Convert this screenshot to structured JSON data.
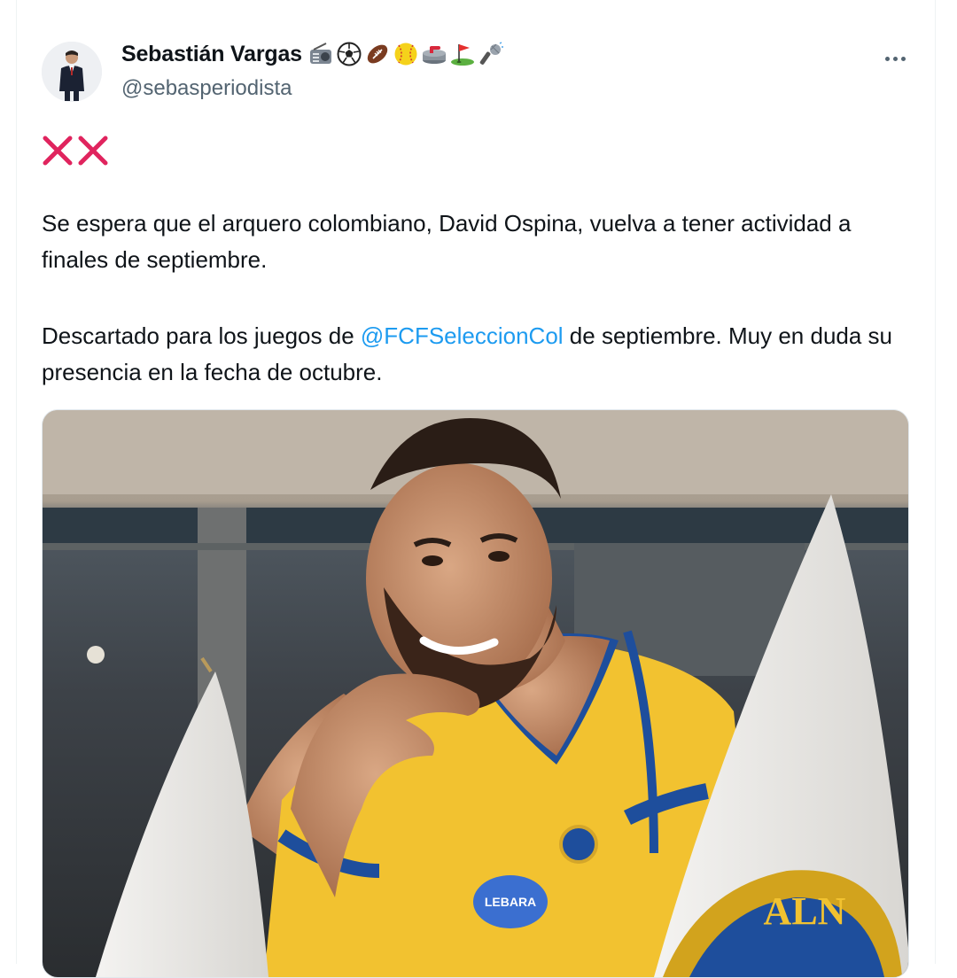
{
  "tweet": {
    "author_name": "Sebastián Vargas",
    "author_handle": "@sebasperiodista",
    "name_emojis": [
      "radio-icon",
      "soccer-ball-icon",
      "american-football-icon",
      "softball-icon",
      "curling-stone-icon",
      "golf-flag-icon",
      "microphone-icon"
    ],
    "marker_emoji": "cross-mark-icon",
    "paragraph_1": "Se espera que el arquero colombiano, David Ospina, vuelva a tener actividad a finales de septiembre.",
    "paragraph_2_before": "Descartado para los juegos de ",
    "mention": "@FCFSeleccionCol",
    "paragraph_2_after": " de septiembre. Muy en duda su presencia en la fecha de octubre.",
    "more_label": "More",
    "photo": {
      "jersey_sponsor": "LEBARA",
      "flag_lettering": "ALN"
    }
  },
  "colors": {
    "text": "#0f1419",
    "secondary_text": "#536471",
    "link": "#1d9bf0",
    "cross_mark": "#e0245e",
    "jersey_yellow": "#f2c230",
    "jersey_trim": "#1e4e9c"
  }
}
